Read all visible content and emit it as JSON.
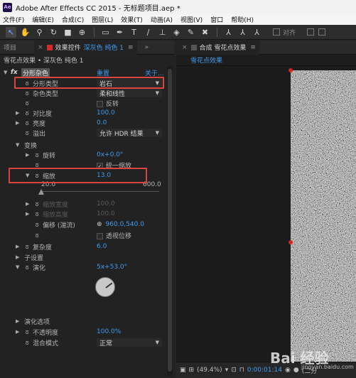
{
  "window": {
    "logo": "Ae",
    "title": "Adobe After Effects CC 2015 - 无标题项目.aep *"
  },
  "menu": [
    "文件(F)",
    "编辑(E)",
    "合成(C)",
    "图层(L)",
    "效果(T)",
    "动画(A)",
    "视图(V)",
    "窗口",
    "帮助(H)"
  ],
  "toolbar": {
    "snap_label": "对齐"
  },
  "left_tabs": {
    "project": "项目",
    "effects_tab_label": "效果控件",
    "effects_tab_layer": "深灰色 纯色 1",
    "menu_glyph": "≡",
    "expand_glyph": "»"
  },
  "fx_header": "雪花点效果 • 深灰色 纯色 1",
  "effect": {
    "fx_label": "fx",
    "name": "分形杂色",
    "reset": "重置",
    "about": "关于...",
    "fractal_type": {
      "label": "分形类型",
      "value": "岩石"
    },
    "noise_type": {
      "label": "杂色类型",
      "value": "柔和线性"
    },
    "invert": {
      "label": "反转"
    },
    "contrast": {
      "label": "对比度",
      "value": "100.0"
    },
    "brightness": {
      "label": "亮度",
      "value": "0.0"
    },
    "overflow": {
      "label": "溢出",
      "value": "允许 HDR 结果"
    },
    "transform": {
      "label": "变换",
      "rotation": {
        "label": "旋转",
        "value": "0x+0.0°"
      },
      "uniform_scale": {
        "label": "统一缩放"
      },
      "scale": {
        "label": "缩放",
        "value": "13.0"
      },
      "slider_min": "20.0",
      "slider_max": "600.0",
      "scale_slider_level": 0.0,
      "scale_width": {
        "label": "缩放宽度",
        "value": "100.0"
      },
      "scale_height": {
        "label": "缩放高度",
        "value": "100.0"
      },
      "offset": {
        "label": "偏移 (湍流)",
        "value": "960.0,540.0"
      },
      "perspective_offset": {
        "label": "透视位移"
      }
    },
    "complexity": {
      "label": "复杂度",
      "value": "6.0"
    },
    "sub_settings": {
      "label": "子设置"
    },
    "evolution": {
      "label": "演化",
      "value": "5x+53.0°",
      "dial_angle_deg": 53
    },
    "evolution_options": {
      "label": "演化选项"
    },
    "opacity": {
      "label": "不透明度",
      "value": "100.0%"
    },
    "blend_mode": {
      "label": "混合模式",
      "value": "正常"
    }
  },
  "right_tabs": {
    "close": "×",
    "comp_tab": "合成 雪花点效果",
    "menu_glyph": "≡",
    "comp_sub": "雪花点效果"
  },
  "viewer_bottom": {
    "zoom": "(49.4%)",
    "time": "0:00:01:14",
    "resolution": "(二分"
  },
  "watermark": {
    "brand": "Bai 经验",
    "url": "jingyan.baidu.com"
  },
  "colors": {
    "accent_blue": "#3f9bf0",
    "highlight_red": "#d9463e",
    "handle_red": "#d32727"
  }
}
